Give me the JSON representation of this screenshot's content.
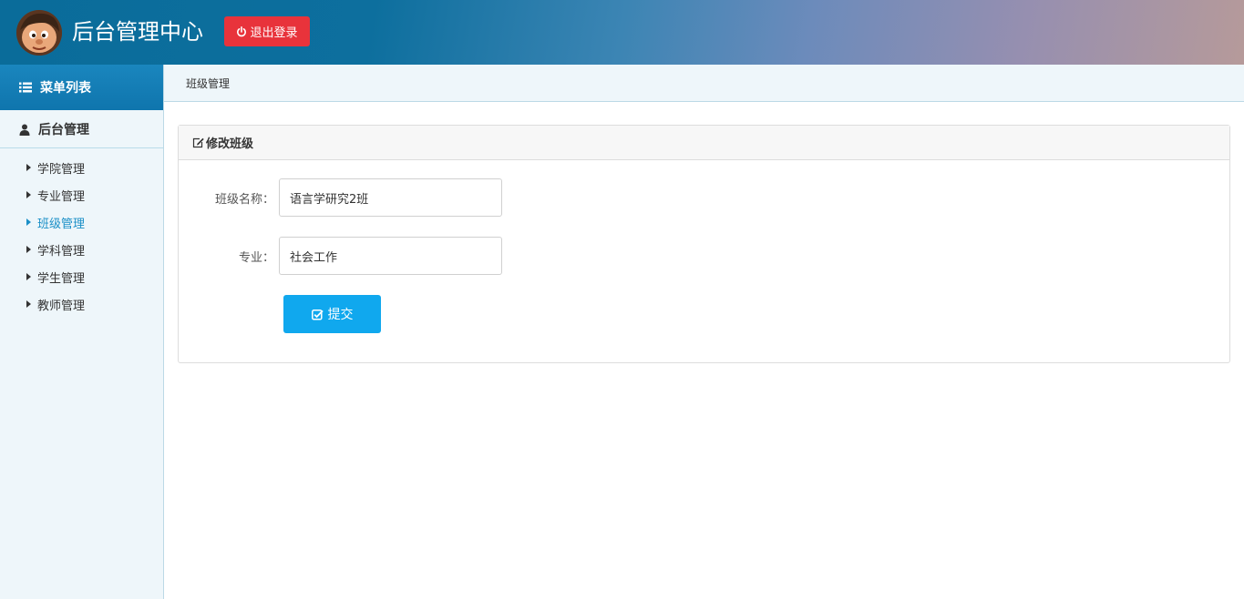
{
  "header": {
    "title": "后台管理中心",
    "logout_label": "退出登录",
    "avatar_icon": "cartoon-avatar",
    "logout_icon": "power-icon",
    "logout_color": "#e8333b"
  },
  "sidebar": {
    "menu_title": "菜单列表",
    "menu_icon": "list-icon",
    "group_title": "后台管理",
    "group_icon": "user-icon",
    "items": [
      {
        "label": "学院管理",
        "active": false
      },
      {
        "label": "专业管理",
        "active": false
      },
      {
        "label": "班级管理",
        "active": true
      },
      {
        "label": "学科管理",
        "active": false
      },
      {
        "label": "学生管理",
        "active": false
      },
      {
        "label": "教师管理",
        "active": false
      }
    ],
    "active_color": "#1a8fc7"
  },
  "breadcrumb": "班级管理",
  "panel": {
    "title": "修改班级",
    "title_icon": "edit-icon",
    "fields": [
      {
        "label": "班级名称：",
        "value": "语言学研究2班"
      },
      {
        "label": "专业：",
        "value": "社会工作"
      }
    ],
    "submit_label": "提交",
    "submit_icon": "check-square-icon",
    "submit_color": "#10a8ee"
  }
}
